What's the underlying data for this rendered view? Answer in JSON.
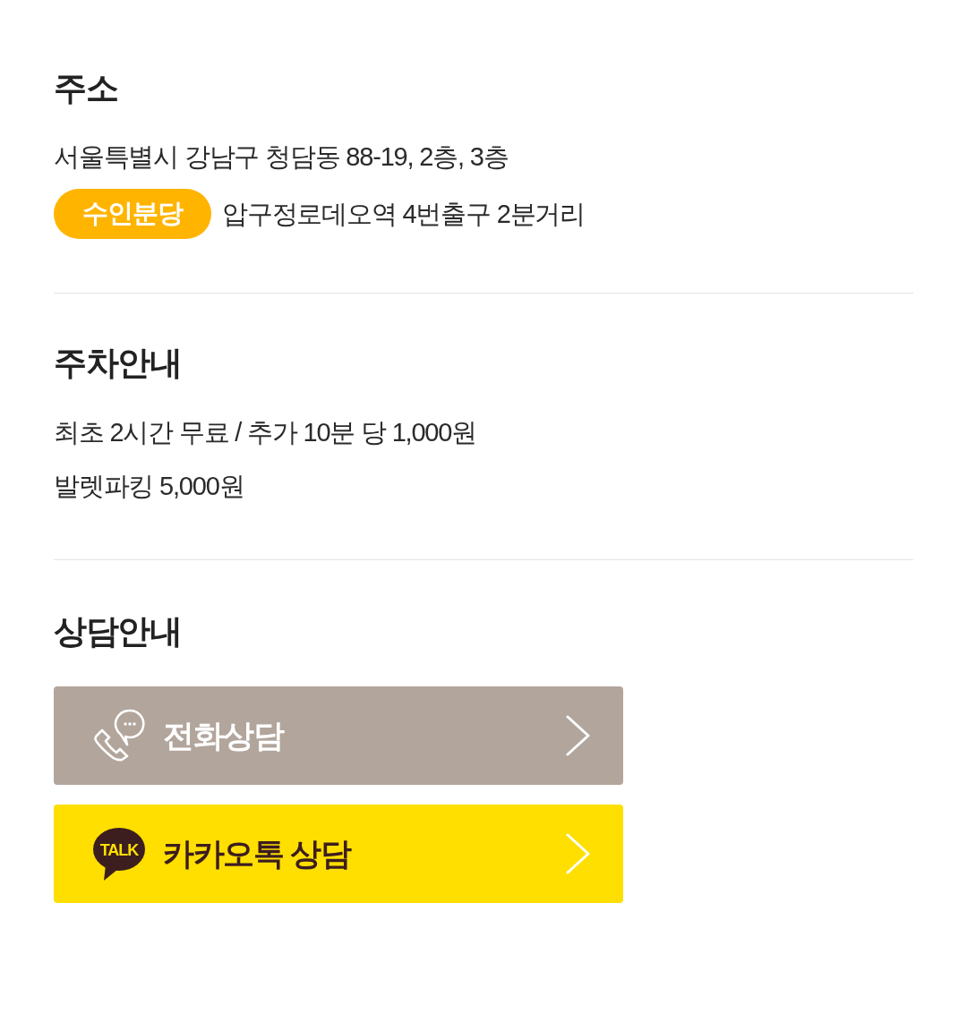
{
  "sections": [
    {
      "title": "주소",
      "lines": [
        {
          "kind": "text",
          "text": "서울특별시 강남구 청담동 88-19, 2층, 3층"
        },
        {
          "kind": "badge",
          "badge": "수인분당",
          "text": "압구정로데오역 4번출구 2분거리"
        }
      ]
    },
    {
      "title": "주차안내",
      "lines": [
        {
          "kind": "text",
          "text": "최초 2시간 무료 / 추가 10분 당 1,000원"
        },
        {
          "kind": "text",
          "text": "발렛파킹 5,000원"
        }
      ]
    },
    {
      "title": "상담안내",
      "buttons": [
        {
          "kind": "phone",
          "label": "전화상담"
        },
        {
          "kind": "kakao",
          "label": "카카오톡 상담",
          "icon_text": "TALK"
        }
      ]
    }
  ]
}
